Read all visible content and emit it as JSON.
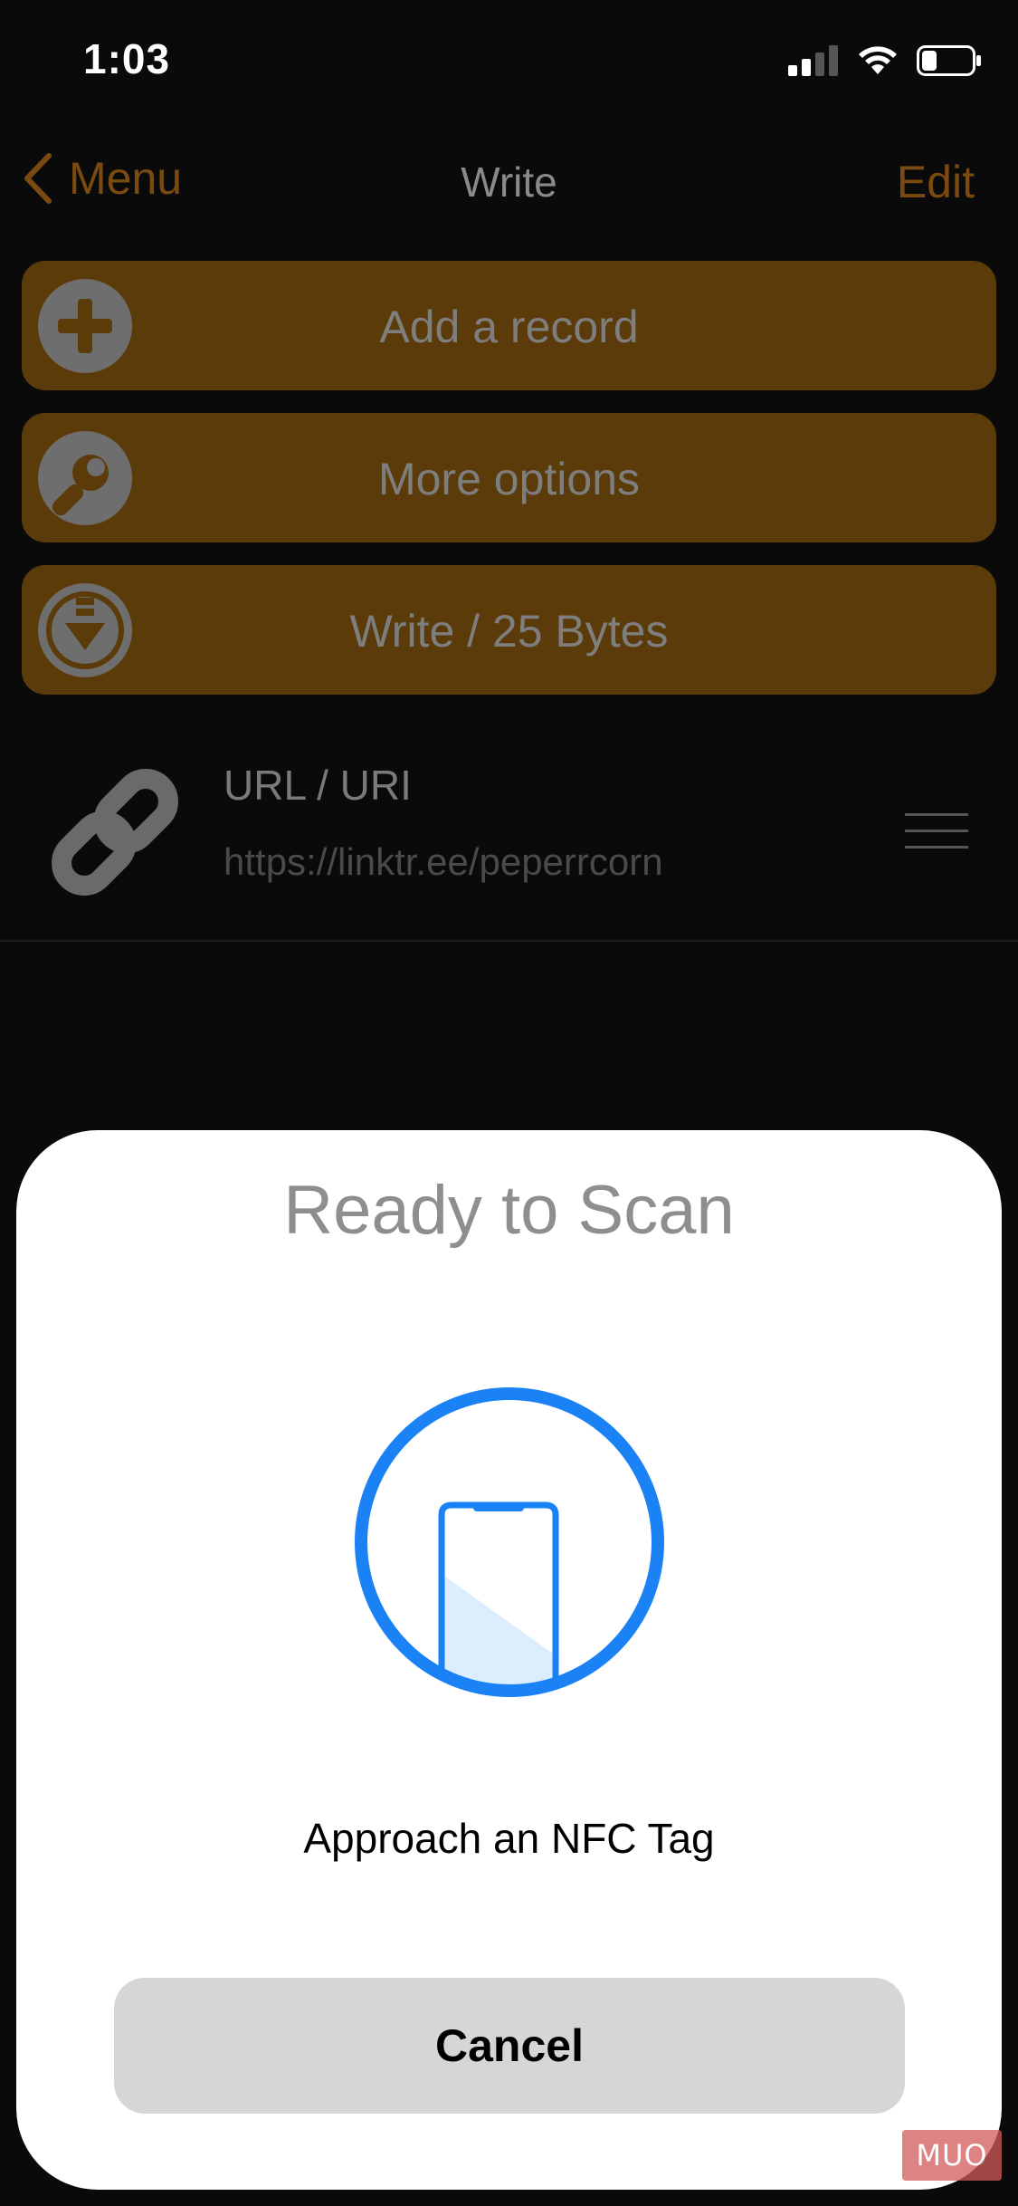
{
  "status_bar": {
    "time": "1:03",
    "icons": [
      "cellular-signal-icon",
      "wifi-icon",
      "battery-icon"
    ]
  },
  "navbar": {
    "back_label": "Menu",
    "title": "Write",
    "edit_label": "Edit"
  },
  "actions": [
    {
      "label": "Add a record",
      "icon": "plus-circle-icon"
    },
    {
      "label": "More options",
      "icon": "wrench-icon"
    },
    {
      "label": "Write / 25 Bytes",
      "icon": "download-write-icon"
    }
  ],
  "record": {
    "type": "URL / URI",
    "value": "https://linktr.ee/peperrcorn",
    "icon": "link-icon"
  },
  "nfc_sheet": {
    "title": "Ready to Scan",
    "message": "Approach an NFC Tag",
    "cancel_label": "Cancel",
    "accent_color": "#1a82f5"
  },
  "watermark": {
    "text": "MUO"
  },
  "colors": {
    "accent_dimmed": "#7a4a10",
    "button_dimmed": "#5c3b0b",
    "sheet_background": "#ffffff",
    "cancel_background": "#d6d6d8"
  }
}
